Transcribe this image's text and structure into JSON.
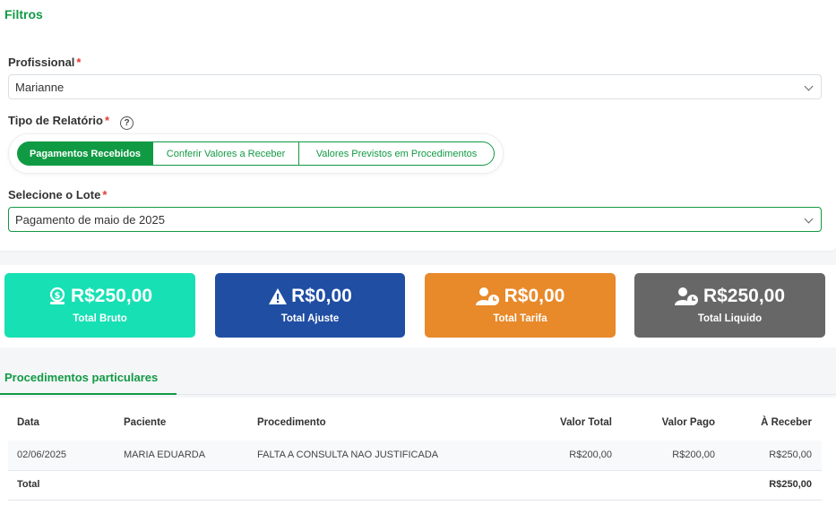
{
  "filters": {
    "title": "Filtros",
    "profissional": {
      "label": "Profissional",
      "required": "*",
      "value": "Marianne"
    },
    "tipo_relatorio": {
      "label": "Tipo de Relatório",
      "required": "*",
      "help": "?",
      "options": [
        "Pagamentos Recebidos",
        "Conferir Valores a Receber",
        "Valores Previstos em Procedimentos"
      ],
      "selected": "Pagamentos Recebidos"
    },
    "lote": {
      "label": "Selecione o Lote",
      "required": "*",
      "value": "Pagamento de maio de 2025"
    }
  },
  "summary": [
    {
      "value": "R$250,00",
      "label": "Total Bruto",
      "icon": "money-bag-icon",
      "color": "#17e0b4"
    },
    {
      "value": "R$0,00",
      "label": "Total Ajuste",
      "icon": "warning-icon",
      "color": "#1f4ea3"
    },
    {
      "value": "R$0,00",
      "label": "Total Tarifa",
      "icon": "user-clock-icon",
      "color": "#e8892a"
    },
    {
      "value": "R$250,00",
      "label": "Total Liquido",
      "icon": "user-clock-icon",
      "color": "#676767"
    }
  ],
  "procedures": {
    "tab": "Procedimentos particulares",
    "columns": [
      "Data",
      "Paciente",
      "Procedimento",
      "Valor Total",
      "Valor Pago",
      "À Receber"
    ],
    "rows": [
      {
        "data": "02/06/2025",
        "paciente": "MARIA EDUARDA",
        "procedimento": "FALTA A CONSULTA NAO JUSTIFICADA",
        "valor_total": "R$200,00",
        "valor_pago": "R$200,00",
        "a_receber": "R$250,00"
      }
    ],
    "total_label": "Total",
    "total_value": "R$250,00"
  },
  "colors": {
    "accent": "#119a44",
    "required": "#e53935"
  }
}
